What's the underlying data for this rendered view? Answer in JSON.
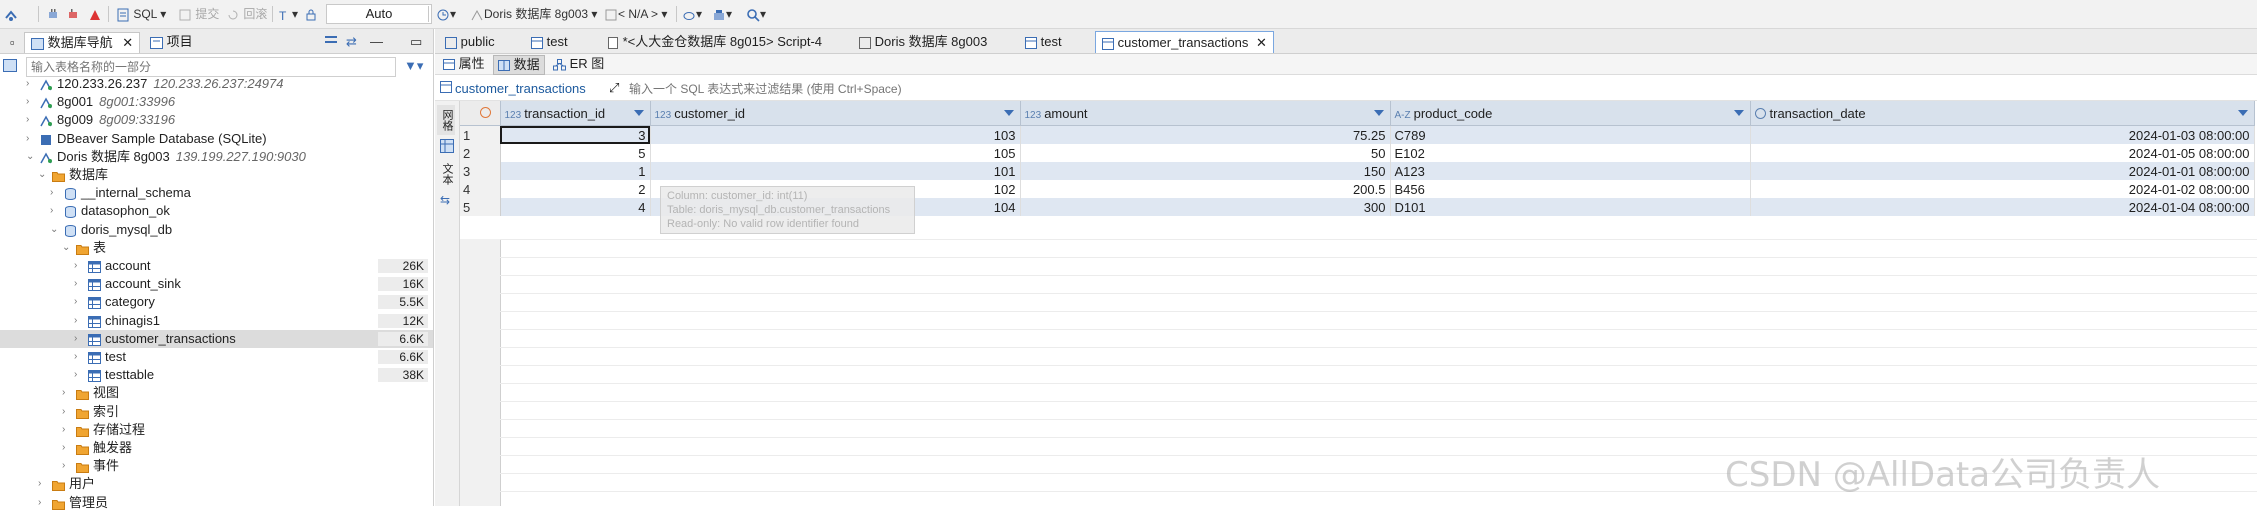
{
  "toolbar": {
    "sql_label": "SQL",
    "commit_label": "提交",
    "rollback_label": "回滚",
    "tx_mode_value": "Auto",
    "datasource_label": "Doris 数据库 8g003",
    "schema_label": "< N/A >"
  },
  "left_panel": {
    "tabs": [
      {
        "label": "数据库导航"
      },
      {
        "label": "项目"
      }
    ],
    "filter_placeholder": "输入表格名称的一部分",
    "tree": [
      {
        "label": "120.233.26.237",
        "sub": "120.233.26.237:24974",
        "icon": "server-icon"
      },
      {
        "label": "8g001",
        "sub": "8g001:33996",
        "icon": "server-icon"
      },
      {
        "label": "8g009",
        "sub": "8g009:33196",
        "icon": "server-icon"
      },
      {
        "label": "DBeaver Sample Database (SQLite)",
        "sub": "",
        "icon": "sqlite-icon"
      },
      {
        "label": "Doris 数据库 8g003",
        "sub": "139.199.227.190:9030",
        "icon": "server-icon"
      },
      {
        "label": "数据库",
        "icon": "folder-icon"
      },
      {
        "label": "__internal_schema",
        "icon": "database-icon"
      },
      {
        "label": "datasophon_ok",
        "icon": "database-icon"
      },
      {
        "label": "doris_mysql_db",
        "icon": "database-icon"
      },
      {
        "label": "表",
        "icon": "folder-icon"
      },
      {
        "label": "account",
        "size": "26K",
        "icon": "table-icon"
      },
      {
        "label": "account_sink",
        "size": "16K",
        "icon": "table-icon"
      },
      {
        "label": "category",
        "size": "5.5K",
        "icon": "table-icon"
      },
      {
        "label": "chinagis1",
        "size": "12K",
        "icon": "table-icon"
      },
      {
        "label": "customer_transactions",
        "size": "6.6K",
        "icon": "table-icon"
      },
      {
        "label": "test",
        "size": "6.6K",
        "icon": "table-icon"
      },
      {
        "label": "testtable",
        "size": "38K",
        "icon": "table-icon"
      },
      {
        "label": "视图",
        "icon": "folder-icon"
      },
      {
        "label": "索引",
        "icon": "folder-icon"
      },
      {
        "label": "存储过程",
        "icon": "folder-icon"
      },
      {
        "label": "触发器",
        "icon": "folder-icon"
      },
      {
        "label": "事件",
        "icon": "folder-icon"
      },
      {
        "label": "用户",
        "icon": "folder-icon"
      },
      {
        "label": "管理员",
        "icon": "folder-icon"
      }
    ]
  },
  "editor": {
    "tabs": [
      {
        "label": "public"
      },
      {
        "label": "test"
      },
      {
        "label": "*<人大金仓数据库 8g015> Script-4"
      },
      {
        "label": "Doris 数据库 8g003"
      },
      {
        "label": "test"
      },
      {
        "label": "customer_transactions"
      }
    ],
    "subtabs": [
      {
        "label": "属性"
      },
      {
        "label": "数据"
      },
      {
        "label": "ER 图"
      }
    ],
    "table_name": "customer_transactions",
    "filter_placeholder": "输入一个 SQL 表达式来过滤结果 (使用 Ctrl+Space)",
    "side_tabs": {
      "grid": "网格",
      "text": "文本"
    },
    "columns": [
      {
        "name": "transaction_id",
        "type": "123"
      },
      {
        "name": "customer_id",
        "type": "123"
      },
      {
        "name": "amount",
        "type": "123"
      },
      {
        "name": "product_code",
        "type": "A-Z"
      },
      {
        "name": "transaction_date",
        "type": "clock"
      }
    ],
    "rows": [
      [
        "1",
        "3",
        "103",
        "75.25",
        "C789",
        "2024-01-03 08:00:00"
      ],
      [
        "2",
        "5",
        "105",
        "50",
        "E102",
        "2024-01-05 08:00:00"
      ],
      [
        "3",
        "1",
        "101",
        "150",
        "A123",
        "2024-01-01 08:00:00"
      ],
      [
        "4",
        "2",
        "102",
        "200.5",
        "B456",
        "2024-01-02 08:00:00"
      ],
      [
        "5",
        "4",
        "104",
        "300",
        "D101",
        "2024-01-04 08:00:00"
      ]
    ],
    "tooltip": [
      "Column: customer_id: int(11)",
      "Table: doris_mysql_db.customer_transactions",
      "Read-only: No valid row identifier found"
    ]
  },
  "watermark": "CSDN @AllData公司负责人",
  "colors": {
    "header_bg": "#d8e1ec",
    "odd_row": "#dfe7f2",
    "accent": "#3b6db4"
  }
}
